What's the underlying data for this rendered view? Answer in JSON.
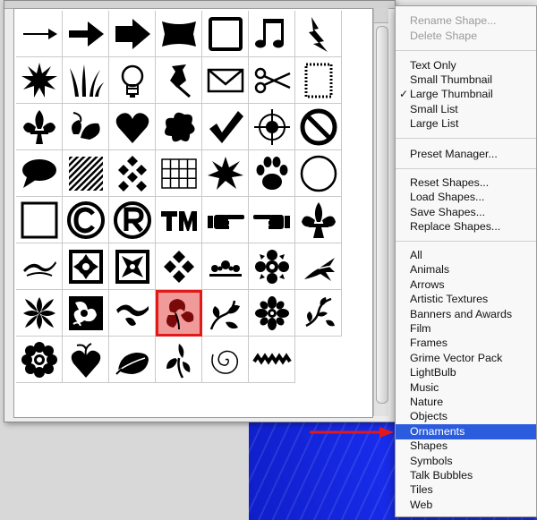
{
  "menu": {
    "rename_shape": "Rename Shape...",
    "delete_shape": "Delete Shape",
    "text_only": "Text Only",
    "small_thumbnail": "Small Thumbnail",
    "large_thumbnail": "Large Thumbnail",
    "small_list": "Small List",
    "large_list": "Large List",
    "preset_manager": "Preset Manager...",
    "reset_shapes": "Reset Shapes...",
    "load_shapes": "Load Shapes...",
    "save_shapes": "Save Shapes...",
    "replace_shapes": "Replace Shapes...",
    "checkmark": "✓",
    "sets": [
      "All",
      "Animals",
      "Arrows",
      "Artistic Textures",
      "Banners and Awards",
      "Film",
      "Frames",
      "Grime Vector Pack",
      "LightBulb",
      "Music",
      "Nature",
      "Objects",
      "Ornaments",
      "Shapes",
      "Symbols",
      "Talk Bubbles",
      "Tiles",
      "Web"
    ],
    "highlighted_set": "Ornaments"
  },
  "colors": {
    "highlight": "#2a5cdd",
    "selection_outline": "#e21919",
    "annotation_arrow": "#e21919"
  },
  "shapes": [
    [
      "arrow-thin-icon",
      "arrow-bold-icon",
      "arrow-block-icon",
      "banner-icon",
      "frame-icon",
      "music-note-icon",
      "lightning-icon"
    ],
    [
      "starburst-icon",
      "grass-icon",
      "lightbulb-icon",
      "pushpin-icon",
      "envelope-icon",
      "scissors-icon",
      "stamp-icon"
    ],
    [
      "fleur-de-lis-icon",
      "leaf-ornament-icon",
      "heart-icon",
      "splat-icon",
      "checkmark-icon",
      "target-icon",
      "no-sign-icon"
    ],
    [
      "speech-bubble-icon",
      "hatch-square-icon",
      "checker-diamond-icon",
      "grid-icon",
      "burst-icon",
      "paw-print-icon",
      "circle-frame-icon"
    ],
    [
      "square-frame-icon",
      "copyright-icon",
      "registered-icon",
      "trademark-icon",
      "pointing-hand-right-icon",
      "pointing-hand-left-icon",
      "fleur-de-lis-2-icon"
    ],
    [
      "ornament-swash-icon",
      "ornament-tile-1-icon",
      "ornament-tile-2-icon",
      "ornament-diamonds-icon",
      "ornament-scroll-icon",
      "ornament-cross-icon",
      "ornament-leaf-fan-icon"
    ],
    [
      "ornament-tile-3-icon",
      "ornament-tile-4-icon",
      "ornament-curl-icon",
      "ornament-leaves-icon",
      "ornament-vine-icon",
      "ornament-flower-icon",
      "ornament-branch-icon"
    ],
    [
      "flower-icon",
      "heart-leaf-icon",
      "leaf-icon",
      "ornament-sprig-icon",
      "spiral-icon",
      "zigzag-icon"
    ]
  ],
  "selected_shape": "ornament-leaves-icon"
}
